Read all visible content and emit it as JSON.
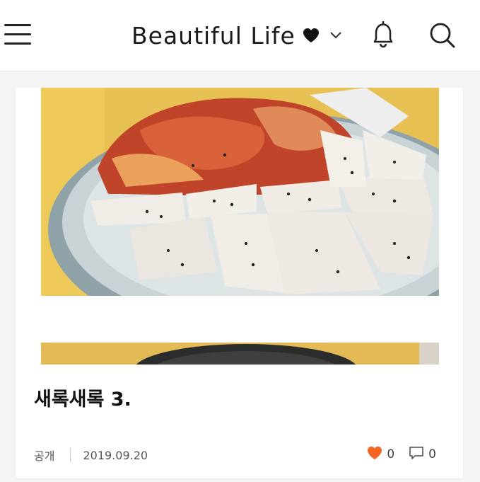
{
  "header": {
    "blog_title": "Beautiful Life",
    "icons": [
      "menu-icon",
      "heart-icon",
      "chevron-down-icon",
      "bell-icon",
      "search-icon"
    ]
  },
  "post": {
    "title": "새록새록 3.",
    "visibility": "공개",
    "date": "2019.09.20",
    "like_count": "0",
    "comment_count": "0",
    "images": [
      "photo-kimchi-tofu",
      "photo-dish-partial"
    ]
  },
  "colors": {
    "accent_heart": "#f26522",
    "text_dark": "#111111",
    "meta_text": "#555555",
    "background": "#f4f4f4"
  }
}
